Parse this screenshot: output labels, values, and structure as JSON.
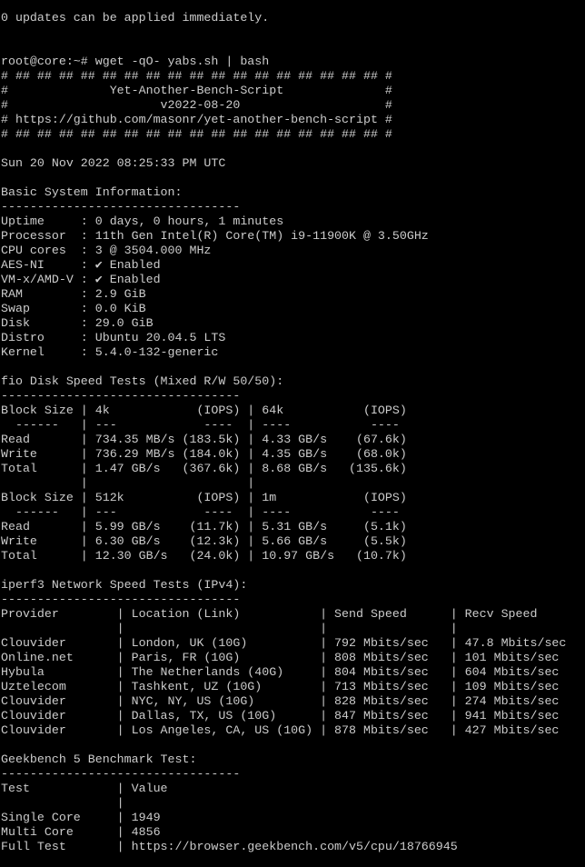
{
  "terminal": {
    "lines": [
      "0 updates can be applied immediately.",
      "",
      "",
      "root@core:~# wget -qO- yabs.sh | bash",
      "# ## ## ## ## ## ## ## ## ## ## ## ## ## ## ## ## ## #",
      "#              Yet-Another-Bench-Script              #",
      "#                     v2022-08-20                    #",
      "# https://github.com/masonr/yet-another-bench-script #",
      "# ## ## ## ## ## ## ## ## ## ## ## ## ## ## ## ## ## #",
      "",
      "Sun 20 Nov 2022 08:25:33 PM UTC",
      "",
      "Basic System Information:",
      "---------------------------------",
      "Uptime     : 0 days, 0 hours, 1 minutes",
      "Processor  : 11th Gen Intel(R) Core(TM) i9-11900K @ 3.50GHz",
      "CPU cores  : 3 @ 3504.000 MHz",
      "AES-NI     : ✔ Enabled",
      "VM-x/AMD-V : ✔ Enabled",
      "RAM        : 2.9 GiB",
      "Swap       : 0.0 KiB",
      "Disk       : 29.0 GiB",
      "Distro     : Ubuntu 20.04.5 LTS",
      "Kernel     : 5.4.0-132-generic",
      "",
      "fio Disk Speed Tests (Mixed R/W 50/50):",
      "---------------------------------",
      "Block Size | 4k            (IOPS) | 64k           (IOPS)",
      "  ------   | ---            ----  | ----           ----",
      "Read       | 734.35 MB/s (183.5k) | 4.33 GB/s    (67.6k)",
      "Write      | 736.29 MB/s (184.0k) | 4.35 GB/s    (68.0k)",
      "Total      | 1.47 GB/s   (367.6k) | 8.68 GB/s   (135.6k)",
      "           |                      |",
      "Block Size | 512k          (IOPS) | 1m            (IOPS)",
      "  ------   | ---            ----  | ----           ----",
      "Read       | 5.99 GB/s    (11.7k) | 5.31 GB/s     (5.1k)",
      "Write      | 6.30 GB/s    (12.3k) | 5.66 GB/s     (5.5k)",
      "Total      | 12.30 GB/s   (24.0k) | 10.97 GB/s   (10.7k)",
      "",
      "iperf3 Network Speed Tests (IPv4):",
      "---------------------------------",
      "Provider        | Location (Link)           | Send Speed      | Recv Speed",
      "                |                           |                 |",
      "Clouvider       | London, UK (10G)          | 792 Mbits/sec   | 47.8 Mbits/sec",
      "Online.net      | Paris, FR (10G)           | 808 Mbits/sec   | 101 Mbits/sec",
      "Hybula          | The Netherlands (40G)     | 804 Mbits/sec   | 604 Mbits/sec",
      "Uztelecom       | Tashkent, UZ (10G)        | 713 Mbits/sec   | 109 Mbits/sec",
      "Clouvider       | NYC, NY, US (10G)         | 828 Mbits/sec   | 274 Mbits/sec",
      "Clouvider       | Dallas, TX, US (10G)      | 847 Mbits/sec   | 941 Mbits/sec",
      "Clouvider       | Los Angeles, CA, US (10G) | 878 Mbits/sec   | 427 Mbits/sec",
      "",
      "Geekbench 5 Benchmark Test:",
      "---------------------------------",
      "Test            | Value",
      "                |",
      "Single Core     | 1949",
      "Multi Core      | 4856",
      "Full Test       | https://browser.geekbench.com/v5/cpu/18766945"
    ]
  }
}
